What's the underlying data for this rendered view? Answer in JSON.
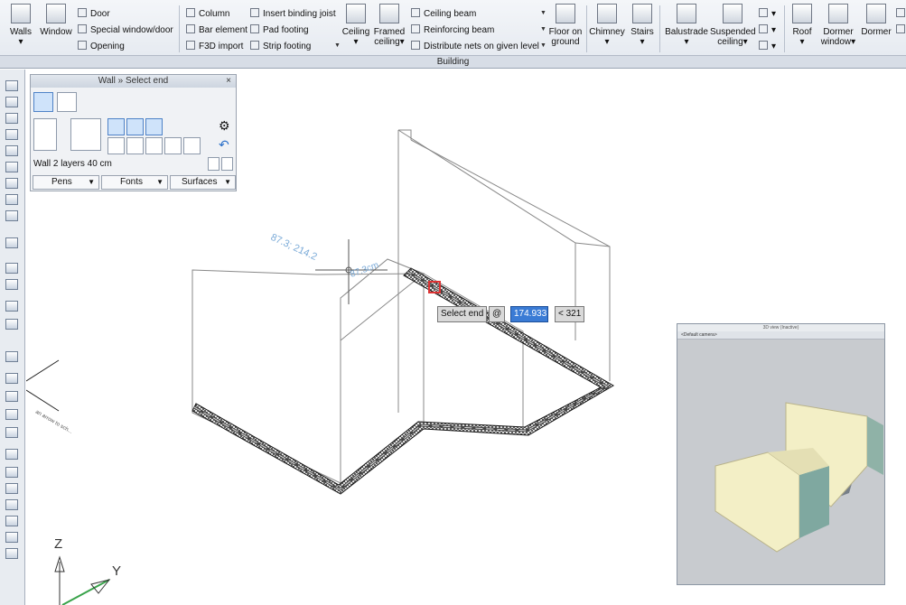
{
  "ribbon": {
    "walls": "Walls",
    "window": "Window",
    "door": "Door",
    "special_window_door": "Special window/door",
    "opening": "Opening",
    "column": "Column",
    "bar_element": "Bar element",
    "f3d_import": "F3D import",
    "insert_binding_joist": "Insert binding joist",
    "pad_footing": "Pad footing",
    "strip_footing": "Strip footing",
    "ceiling": "Ceiling",
    "framed_ceiling": "Framed ceiling",
    "ceiling_beam": "Ceiling beam",
    "reinforcing_beam": "Reinforcing beam",
    "distribute_nets": "Distribute nets on given level",
    "floor_on_ground_1": "Floor on",
    "floor_on_ground_2": "ground",
    "chimney": "Chimney",
    "stairs": "Stairs",
    "balustrade": "Balustrade",
    "suspended_ceiling_1": "Suspended",
    "suspended_ceiling_2": "ceiling",
    "roof": "Roof",
    "dormer_window_1": "Dormer",
    "dormer_window_2": "window",
    "dormer": "Dormer",
    "group_label": "Building"
  },
  "panel": {
    "title": "Wall » Select end",
    "close": "×",
    "wall_type": "Wall 2 layers 40 cm",
    "pens": "Pens",
    "fonts": "Fonts",
    "surfaces": "Surfaces"
  },
  "tooltip": {
    "select_end": "Select end",
    "at": "@",
    "value": "174.933",
    "angle": "< 321"
  },
  "canvas": {
    "coords_text": "87.3; 214.2",
    "dim_text": "87.3cm",
    "axis_z": "Z",
    "axis_y": "Y",
    "arrow_note": "an arrow to sch..."
  },
  "view3d": {
    "title": "3D view (Inactive)",
    "camera_label": "<Default camera>"
  },
  "colors": {
    "ribbon_bg": "#e3e8ef",
    "highlight": "#3a7bd5",
    "wall_fill": "#f3efc6",
    "wall_side": "#7fa8a0"
  }
}
